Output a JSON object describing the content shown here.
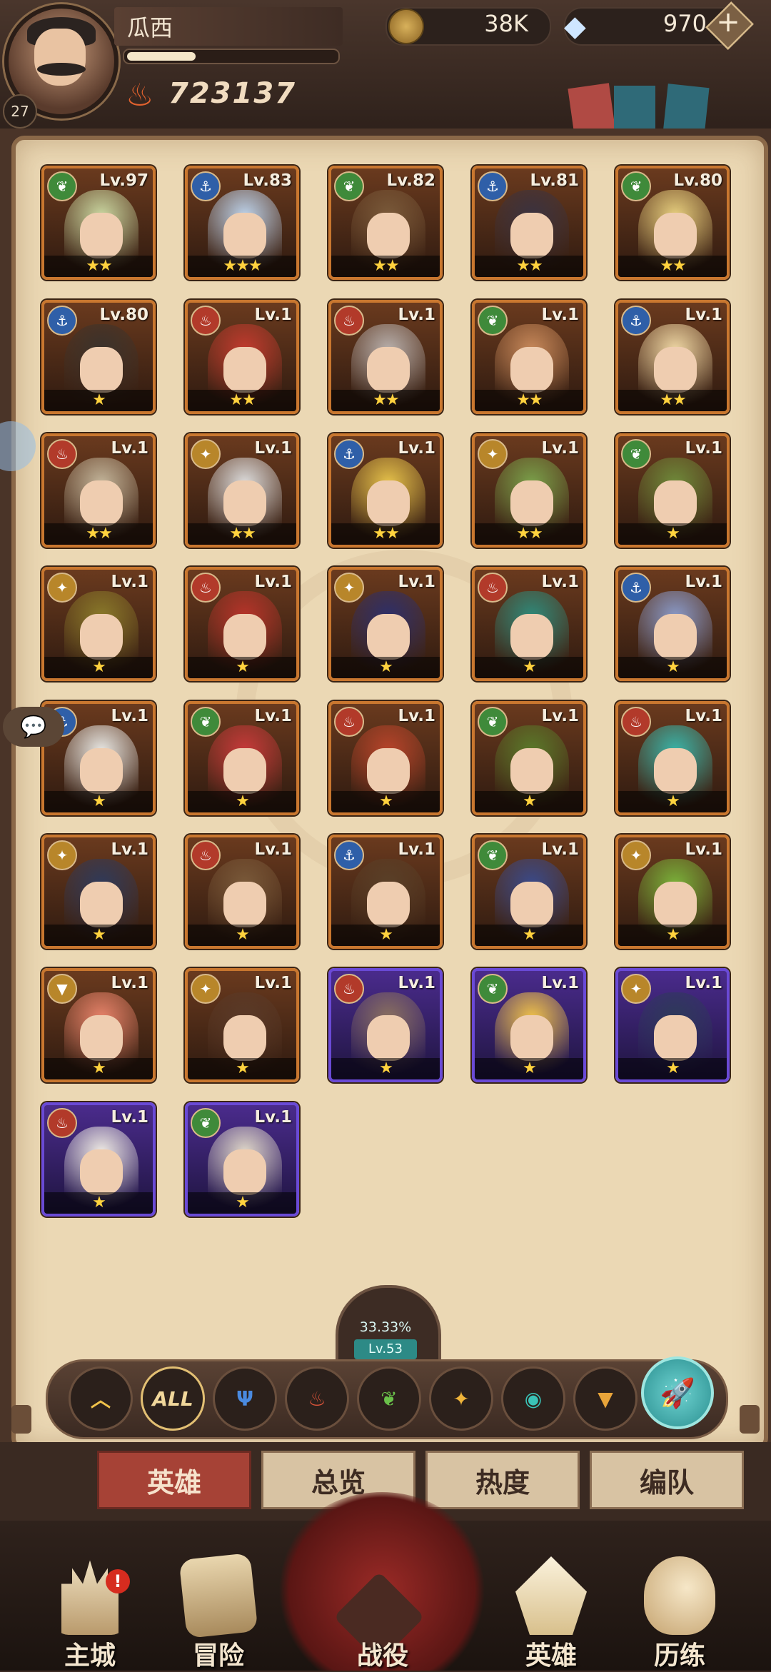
{
  "player": {
    "name": "瓜西",
    "level": "27",
    "exp_fraction": 0.33,
    "power": "723137"
  },
  "resources": {
    "gold": "38K",
    "gems": "970",
    "add_symbol": "+"
  },
  "heroes": [
    {
      "level": "Lv.97",
      "faction": "nature",
      "stars": 2,
      "rarity": "gold",
      "palette": "#c9d6a0"
    },
    {
      "level": "Lv.83",
      "faction": "water",
      "stars": 3,
      "rarity": "gold",
      "palette": "#bcd2ea"
    },
    {
      "level": "Lv.82",
      "faction": "nature",
      "stars": 2,
      "rarity": "gold",
      "palette": "#7a5a3a"
    },
    {
      "level": "Lv.81",
      "faction": "water",
      "stars": 2,
      "rarity": "gold",
      "palette": "#3b3340"
    },
    {
      "level": "Lv.80",
      "faction": "nature",
      "stars": 2,
      "rarity": "gold",
      "palette": "#e7cf7e"
    },
    {
      "level": "Lv.80",
      "faction": "water",
      "stars": 1,
      "rarity": "gold",
      "palette": "#3b332c"
    },
    {
      "level": "Lv.1",
      "faction": "fire",
      "stars": 2,
      "rarity": "gold",
      "palette": "#c23b2e"
    },
    {
      "level": "Lv.1",
      "faction": "fire",
      "stars": 2,
      "rarity": "gold",
      "palette": "#b8b0ac"
    },
    {
      "level": "Lv.1",
      "faction": "nature",
      "stars": 2,
      "rarity": "gold",
      "palette": "#c8895a"
    },
    {
      "level": "Lv.1",
      "faction": "water",
      "stars": 2,
      "rarity": "gold",
      "palette": "#efd7a4"
    },
    {
      "level": "Lv.1",
      "faction": "fire",
      "stars": 2,
      "rarity": "gold",
      "palette": "#c3b59a"
    },
    {
      "level": "Lv.1",
      "faction": "light",
      "stars": 2,
      "rarity": "gold",
      "palette": "#dcdcdc"
    },
    {
      "level": "Lv.1",
      "faction": "water",
      "stars": 2,
      "rarity": "gold",
      "palette": "#e6c24a"
    },
    {
      "level": "Lv.1",
      "faction": "light",
      "stars": 2,
      "rarity": "gold",
      "palette": "#7aa04a"
    },
    {
      "level": "Lv.1",
      "faction": "nature",
      "stars": 1,
      "rarity": "gold",
      "palette": "#6f8a3a"
    },
    {
      "level": "Lv.1",
      "faction": "light",
      "stars": 1,
      "rarity": "gold",
      "palette": "#8a7a2a"
    },
    {
      "level": "Lv.1",
      "faction": "fire",
      "stars": 1,
      "rarity": "gold",
      "palette": "#b8342a"
    },
    {
      "level": "Lv.1",
      "faction": "light",
      "stars": 1,
      "rarity": "gold",
      "palette": "#2e2f6a"
    },
    {
      "level": "Lv.1",
      "faction": "fire",
      "stars": 1,
      "rarity": "gold",
      "palette": "#2f8a7a"
    },
    {
      "level": "Lv.1",
      "faction": "water",
      "stars": 1,
      "rarity": "gold",
      "palette": "#8a9ac8"
    },
    {
      "level": "Lv.1",
      "faction": "water",
      "stars": 1,
      "rarity": "gold",
      "palette": "#e8e8e4"
    },
    {
      "level": "Lv.1",
      "faction": "nature",
      "stars": 1,
      "rarity": "gold",
      "palette": "#c83a3a"
    },
    {
      "level": "Lv.1",
      "faction": "fire",
      "stars": 1,
      "rarity": "gold",
      "palette": "#b8442a"
    },
    {
      "level": "Lv.1",
      "faction": "nature",
      "stars": 1,
      "rarity": "gold",
      "palette": "#5a7a2a"
    },
    {
      "level": "Lv.1",
      "faction": "fire",
      "stars": 1,
      "rarity": "gold",
      "palette": "#3ab4a8"
    },
    {
      "level": "Lv.1",
      "faction": "light",
      "stars": 1,
      "rarity": "gold",
      "palette": "#2f3a5a"
    },
    {
      "level": "Lv.1",
      "faction": "fire",
      "stars": 1,
      "rarity": "gold",
      "palette": "#7a5a3a"
    },
    {
      "level": "Lv.1",
      "faction": "water",
      "stars": 1,
      "rarity": "gold",
      "palette": "#5a4028"
    },
    {
      "level": "Lv.1",
      "faction": "nature",
      "stars": 1,
      "rarity": "gold",
      "palette": "#3a4a8a"
    },
    {
      "level": "Lv.1",
      "faction": "light",
      "stars": 1,
      "rarity": "gold",
      "palette": "#7ab23a"
    },
    {
      "level": "Lv.1",
      "faction": "mech",
      "stars": 1,
      "rarity": "gold",
      "palette": "#e8836a"
    },
    {
      "level": "Lv.1",
      "faction": "light",
      "stars": 1,
      "rarity": "gold",
      "palette": "#5a3a28"
    },
    {
      "level": "Lv.1",
      "faction": "fire",
      "stars": 1,
      "rarity": "purple",
      "palette": "#8a7060"
    },
    {
      "level": "Lv.1",
      "faction": "nature",
      "stars": 1,
      "rarity": "purple",
      "palette": "#f0c24a"
    },
    {
      "level": "Lv.1",
      "faction": "light",
      "stars": 1,
      "rarity": "purple",
      "palette": "#2e3a5a"
    },
    {
      "level": "Lv.1",
      "faction": "fire",
      "stars": 1,
      "rarity": "purple",
      "palette": "#f0ece4"
    },
    {
      "level": "Lv.1",
      "faction": "nature",
      "stars": 1,
      "rarity": "purple",
      "palette": "#e0d8c8"
    }
  ],
  "collection_progress": {
    "percent": "33.33%",
    "level": "Lv.53"
  },
  "filters": [
    {
      "id": "collapse",
      "label": "",
      "icon": "chevron-up-icon",
      "color": "#f0c24a"
    },
    {
      "id": "all",
      "label": "ALL",
      "icon": "",
      "color": "#f1d79b"
    },
    {
      "id": "water",
      "label": "",
      "icon": "trident-icon",
      "color": "#4a8ae0"
    },
    {
      "id": "fire",
      "label": "",
      "icon": "flame-icon",
      "color": "#e0553a"
    },
    {
      "id": "nature",
      "label": "",
      "icon": "leaf-icon",
      "color": "#6ac04a"
    },
    {
      "id": "light",
      "label": "",
      "icon": "star-burst-icon",
      "color": "#f0b43a"
    },
    {
      "id": "eye",
      "label": "",
      "icon": "eye-icon",
      "color": "#3ac4b8"
    },
    {
      "id": "mech",
      "label": "",
      "icon": "triangle-blade-icon",
      "color": "#e8a43a"
    }
  ],
  "sub_tabs": [
    "英雄",
    "总览",
    "热度",
    "编队"
  ],
  "nav": [
    {
      "label": "主城",
      "icon": "castle-icon",
      "alert": "!"
    },
    {
      "label": "冒险",
      "icon": "scroll-icon",
      "alert": ""
    },
    {
      "label": "战役",
      "icon": "dragon-icon",
      "alert": ""
    },
    {
      "label": "英雄",
      "icon": "hero-crown-icon",
      "alert": ""
    },
    {
      "label": "历练",
      "icon": "duck-icon",
      "alert": ""
    }
  ],
  "colors": {
    "gold_frame": "#c9772f",
    "purple_frame": "#6a4ad6",
    "parchment": "#ebd8b4",
    "active_tab": "#a64236"
  }
}
